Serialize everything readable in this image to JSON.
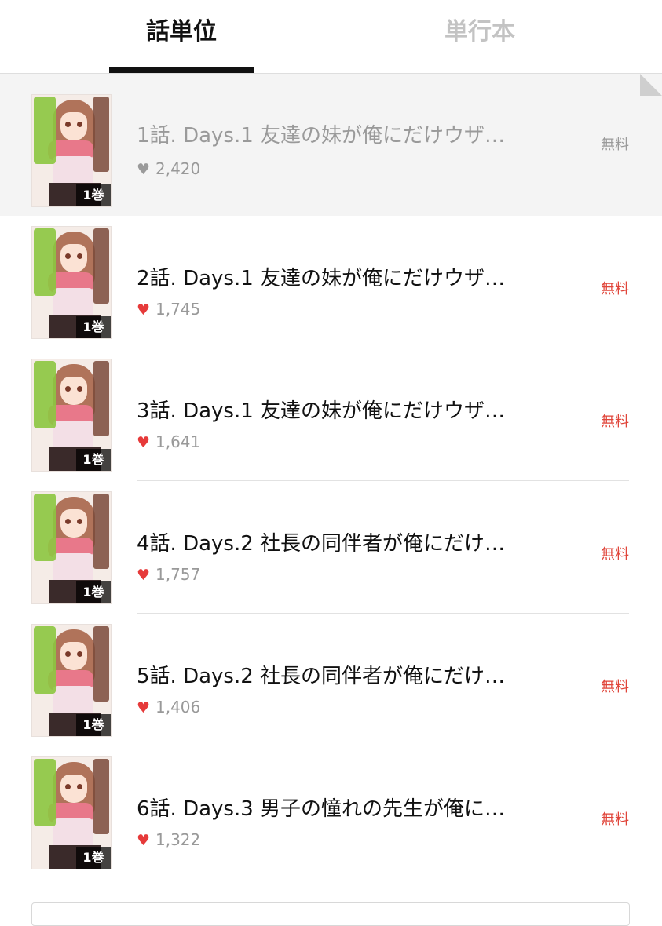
{
  "tabs": [
    {
      "label": "話単位",
      "active": true
    },
    {
      "label": "単行本",
      "active": false
    }
  ],
  "episodes": [
    {
      "title": "1話. Days.1 友達の妹が俺にだけウザ…",
      "likes": "2,420",
      "price": "無料",
      "volume": "1巻",
      "read": true
    },
    {
      "title": "2話. Days.1 友達の妹が俺にだけウザ…",
      "likes": "1,745",
      "price": "無料",
      "volume": "1巻",
      "read": false
    },
    {
      "title": "3話. Days.1 友達の妹が俺にだけウザ…",
      "likes": "1,641",
      "price": "無料",
      "volume": "1巻",
      "read": false
    },
    {
      "title": "4話. Days.2 社長の同伴者が俺にだけ…",
      "likes": "1,757",
      "price": "無料",
      "volume": "1巻",
      "read": false
    },
    {
      "title": "5話. Days.2 社長の同伴者が俺にだけ…",
      "likes": "1,406",
      "price": "無料",
      "volume": "1巻",
      "read": false
    },
    {
      "title": "6話. Days.3 男子の憧れの先生が俺に…",
      "likes": "1,322",
      "price": "無料",
      "volume": "1巻",
      "read": false
    }
  ],
  "colors": {
    "accent_price": "#e0453a",
    "heart": "#e63a3a",
    "read_row_bg": "#f4f4f4"
  }
}
